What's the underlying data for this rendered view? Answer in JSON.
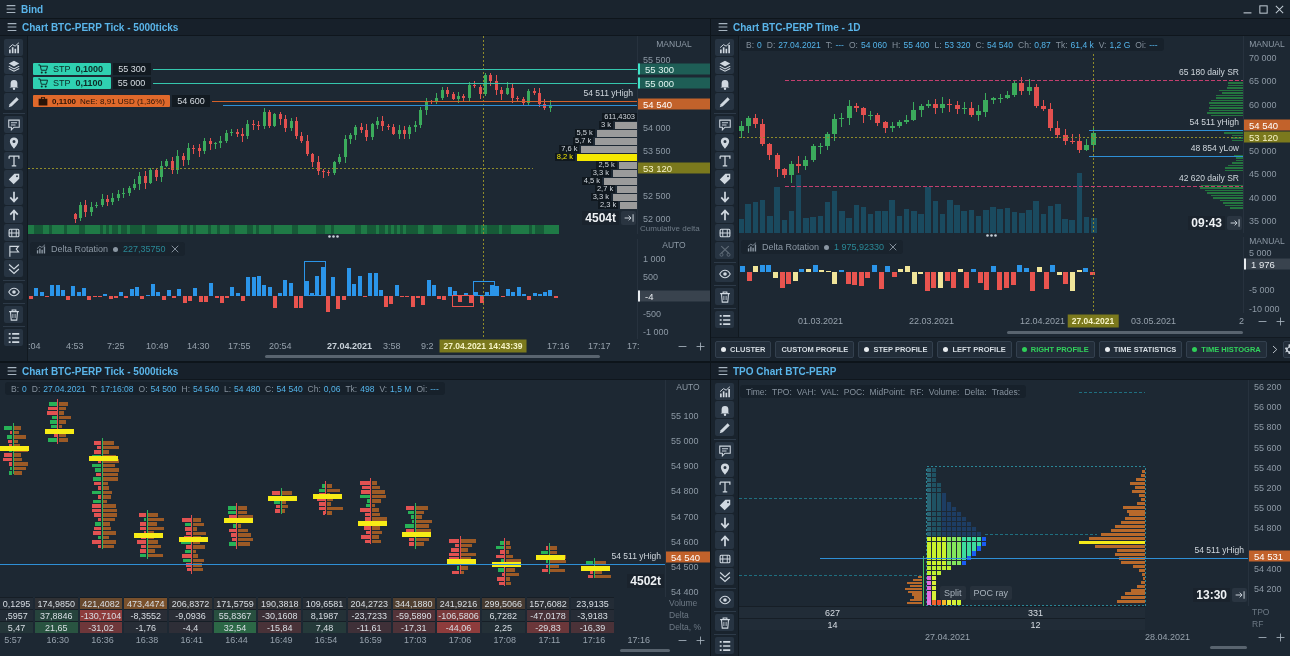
{
  "window": {
    "title": "Bind"
  },
  "panels": [
    {
      "kind": "tick_chart",
      "title": "Chart BTC-PERP Tick - 5000ticks",
      "price_axis": {
        "mode": "MANUAL",
        "ticks": [
          "55 500",
          "54 000",
          "53 500",
          "52 500",
          "52 000"
        ],
        "labels": [
          {
            "text": "55 300",
            "kind": "order",
            "color": "#1e5e56"
          },
          {
            "text": "55 000",
            "kind": "order",
            "color": "#1e5e56"
          },
          {
            "text": "54 540",
            "kind": "last",
            "color": "#c2622b"
          },
          {
            "text": "53 120",
            "kind": "cursor",
            "color": "#7b791d"
          }
        ],
        "caption": "Cumulative delta"
      },
      "orders": [
        {
          "kind": "stop",
          "type": "STP",
          "quantity": "0,1000",
          "price": "55 300"
        },
        {
          "kind": "stop",
          "type": "STP",
          "quantity": "0,1100",
          "price": "55 000"
        },
        {
          "kind": "position",
          "quantity": "0,1100",
          "details": "NeE: 8,91 USD (1,36%)",
          "price": "54 600"
        }
      ],
      "level_lines": [
        {
          "text": "54 511 yHigh",
          "kind": "yesterday",
          "color": "#2e8fd6"
        }
      ],
      "volume_profile": {
        "total": "611,4303",
        "bars": [
          {
            "text": "3 k",
            "highlighted": false
          },
          {
            "text": "5,5 k",
            "highlighted": false
          },
          {
            "text": "5,7 k",
            "highlighted": false
          },
          {
            "text": "7,6 k",
            "highlighted": false
          },
          {
            "text": "8,2 k",
            "highlighted": true
          },
          {
            "text": "2,5 k",
            "highlighted": false
          },
          {
            "text": "3,3 k",
            "highlighted": false
          },
          {
            "text": "4,5 k",
            "highlighted": false
          },
          {
            "text": "2,7 k",
            "highlighted": false
          },
          {
            "text": "3,3 k",
            "highlighted": false
          },
          {
            "text": "2,3 k",
            "highlighted": false
          }
        ]
      },
      "bar_counter": "4504t",
      "indicator": {
        "name": "Delta Rotation",
        "value": "227,35750",
        "mode": "AUTO",
        "ticks": [
          "1 000",
          "500",
          "-500",
          "-1 000"
        ],
        "current": "-4"
      },
      "time_axis": [
        {
          "text": ":04",
          "kind": "time"
        },
        {
          "text": "4:53",
          "kind": "time"
        },
        {
          "text": "7:25",
          "kind": "time"
        },
        {
          "text": "10:49",
          "kind": "time"
        },
        {
          "text": "14:30",
          "kind": "time"
        },
        {
          "text": "17:55",
          "kind": "time"
        },
        {
          "text": "20:54",
          "kind": "time"
        },
        {
          "text": "27.04.2021",
          "kind": "date"
        },
        {
          "text": "3:58",
          "kind": "time"
        },
        {
          "text": "9:2",
          "kind": "time"
        },
        {
          "text": "27.04.2021 14:43:39",
          "kind": "cursor"
        },
        {
          "text": "17:16",
          "kind": "time"
        },
        {
          "text": "17:17",
          "kind": "time"
        },
        {
          "text": "17:",
          "kind": "time"
        }
      ]
    },
    {
      "kind": "time_chart",
      "title": "Chart BTC-PERP Time - 1D",
      "info": [
        {
          "label": "B:",
          "value": "0"
        },
        {
          "label": "D:",
          "value": "27.04.2021"
        },
        {
          "label": "T:",
          "value": "---"
        },
        {
          "label": "O:",
          "value": "54 060"
        },
        {
          "label": "H:",
          "value": "55 400"
        },
        {
          "label": "L:",
          "value": "53 320"
        },
        {
          "label": "C:",
          "value": "54 540"
        },
        {
          "label": "Ch:",
          "value": "0,87"
        },
        {
          "label": "Tk:",
          "value": "61,4 k"
        },
        {
          "label": "V:",
          "value": "1,2 G"
        },
        {
          "label": "Oi:",
          "value": "---"
        }
      ],
      "price_axis": {
        "mode": "MANUAL",
        "ticks": [
          "70 000",
          "65 000",
          "60 000",
          "50 000",
          "45 000",
          "40 000",
          "35 000"
        ],
        "labels": [
          {
            "text": "54 540",
            "kind": "last",
            "color": "#c2622b"
          },
          {
            "text": "53 120",
            "kind": "cursor",
            "color": "#7b791d"
          }
        ]
      },
      "level_lines": [
        {
          "text": "65 180 daily SR",
          "kind": "daily",
          "color": "#c23f6e"
        },
        {
          "text": "54 511 yHigh",
          "kind": "yesterday",
          "color": "#2e8fd6"
        },
        {
          "text": "48 854 yLow",
          "kind": "yesterday",
          "color": "#2e8fd6"
        },
        {
          "text": "42 620 daily SR",
          "kind": "daily",
          "color": "#c23f6e"
        }
      ],
      "timer": "09:43",
      "indicator": {
        "name": "Delta Rotation",
        "value": "1 975,92330",
        "mode": "MANUAL",
        "ticks": [
          "5 000",
          "-5 000",
          "-10 000"
        ],
        "current": "1 976"
      },
      "time_axis": [
        {
          "text": "01.03.2021",
          "kind": "time"
        },
        {
          "text": "22.03.2021",
          "kind": "time"
        },
        {
          "text": "12.04.2021",
          "kind": "time"
        },
        {
          "text": "27.04.2021",
          "kind": "cursor"
        },
        {
          "text": "03.05.2021",
          "kind": "time"
        },
        {
          "text": "2",
          "kind": "time"
        }
      ],
      "profile_tabs": [
        {
          "label": "CLUSTER",
          "kind": "toggle",
          "on": false
        },
        {
          "label": "CUSTOM PROFILE",
          "kind": "button"
        },
        {
          "label": "STEP PROFILE",
          "kind": "toggle",
          "on": false
        },
        {
          "label": "LEFT PROFILE",
          "kind": "toggle",
          "on": false
        },
        {
          "label": "RIGHT PROFILE",
          "kind": "toggle",
          "on": true
        },
        {
          "label": "TIME STATISTICS",
          "kind": "toggle",
          "on": false
        },
        {
          "label": "TIME HISTOGRA",
          "kind": "toggle",
          "on": true
        }
      ]
    },
    {
      "kind": "cluster_chart",
      "title": "Chart BTC-PERP Tick - 5000ticks",
      "info": [
        {
          "label": "B:",
          "value": "0"
        },
        {
          "label": "D:",
          "value": "27.04.2021"
        },
        {
          "label": "T:",
          "value": "17:16:08"
        },
        {
          "label": "O:",
          "value": "54 500"
        },
        {
          "label": "H:",
          "value": "54 540"
        },
        {
          "label": "L:",
          "value": "54 480"
        },
        {
          "label": "C:",
          "value": "54 540"
        },
        {
          "label": "Ch:",
          "value": "0,06"
        },
        {
          "label": "Tk:",
          "value": "498"
        },
        {
          "label": "V:",
          "value": "1,5 M"
        },
        {
          "label": "Oi:",
          "value": "---"
        }
      ],
      "price_axis": {
        "mode": "AUTO",
        "ticks": [
          "55 100",
          "55 000",
          "54 900",
          "54 800",
          "54 700",
          "54 600",
          "54 500",
          "54 400"
        ],
        "labels": [
          {
            "text": "54 540",
            "kind": "last",
            "color": "#c2622b"
          }
        ]
      },
      "level_lines": [
        {
          "text": "54 511 yHigh",
          "kind": "yesterday",
          "color": "#2e8fd6"
        }
      ],
      "bar_counter": "4502t",
      "stats_table": {
        "rows": [
          {
            "name": "Volume",
            "kind": "volume",
            "cells": [
              "0,1295",
              "174,9850",
              "421,4082",
              "473,4474",
              "206,8372",
              "171,5759",
              "190,3818",
              "109,6581",
              "204,2723",
              "344,1880",
              "241,9216",
              "299,5066",
              "157,6082",
              "23,9135"
            ]
          },
          {
            "name": "Delta",
            "kind": "delta",
            "cells": [
              ",5957",
              "37,8846",
              "-130,7104",
              "-8,3552",
              "-9,0936",
              "55,8367",
              "-30,1608",
              "8,1987",
              "-23,7233",
              "-59,5890",
              "-106,5806",
              "6,7282",
              "-47,0178",
              "-3,9183"
            ]
          },
          {
            "name": "Delta, %",
            "kind": "delta",
            "cells": [
              "5,47",
              "21,65",
              "-31,02",
              "-1,76",
              "-4,4",
              "32,54",
              "-15,84",
              "7,48",
              "-11,61",
              "-17,31",
              "-44,06",
              "2,25",
              "-29,83",
              "-16,39"
            ]
          }
        ]
      },
      "time_axis": [
        {
          "text": "5:57",
          "kind": "time"
        },
        {
          "text": "16:30",
          "kind": "time"
        },
        {
          "text": "16:36",
          "kind": "time"
        },
        {
          "text": "16:38",
          "kind": "time"
        },
        {
          "text": "16:41",
          "kind": "time"
        },
        {
          "text": "16:44",
          "kind": "time"
        },
        {
          "text": "16:49",
          "kind": "time"
        },
        {
          "text": "16:54",
          "kind": "time"
        },
        {
          "text": "16:59",
          "kind": "time"
        },
        {
          "text": "17:03",
          "kind": "time"
        },
        {
          "text": "17:06",
          "kind": "time"
        },
        {
          "text": "17:08",
          "kind": "time"
        },
        {
          "text": "17:11",
          "kind": "time"
        },
        {
          "text": "17:16",
          "kind": "time"
        },
        {
          "text": "17:16",
          "kind": "time"
        }
      ]
    },
    {
      "kind": "tpo_chart",
      "title": "TPO Chart BTC-PERP",
      "info": [
        {
          "label": "Time:"
        },
        {
          "label": "TPO:"
        },
        {
          "label": "VAH:"
        },
        {
          "label": "VAL:"
        },
        {
          "label": "POC:"
        },
        {
          "label": "MidPoint:"
        },
        {
          "label": "RF:"
        },
        {
          "label": "Volume:"
        },
        {
          "label": "Delta:"
        },
        {
          "label": "Trades:"
        }
      ],
      "price_axis": {
        "ticks": [
          "56 200",
          "56 000",
          "55 800",
          "55 600",
          "55 400",
          "55 200",
          "55 000",
          "54 800",
          "54 400",
          "54 200"
        ],
        "labels": [
          {
            "text": "54 531",
            "kind": "last",
            "color": "#c2622b"
          }
        ]
      },
      "level_lines": [
        {
          "text": "54 511 yHigh",
          "kind": "yesterday",
          "color": "#2e8fd6"
        }
      ],
      "profile_buttons": [
        "Split",
        "POC ray"
      ],
      "timer": "13:30",
      "stats_table": {
        "rows": [
          {
            "name": "TPO",
            "kind": "plain",
            "cells": [
              "627",
              "331"
            ]
          },
          {
            "name": "RF",
            "kind": "plain",
            "cells": [
              "14",
              "12"
            ]
          }
        ]
      },
      "time_axis": [
        {
          "text": "27.04.2021",
          "kind": "time"
        },
        {
          "text": "28.04.2021",
          "kind": "time"
        }
      ]
    }
  ]
}
